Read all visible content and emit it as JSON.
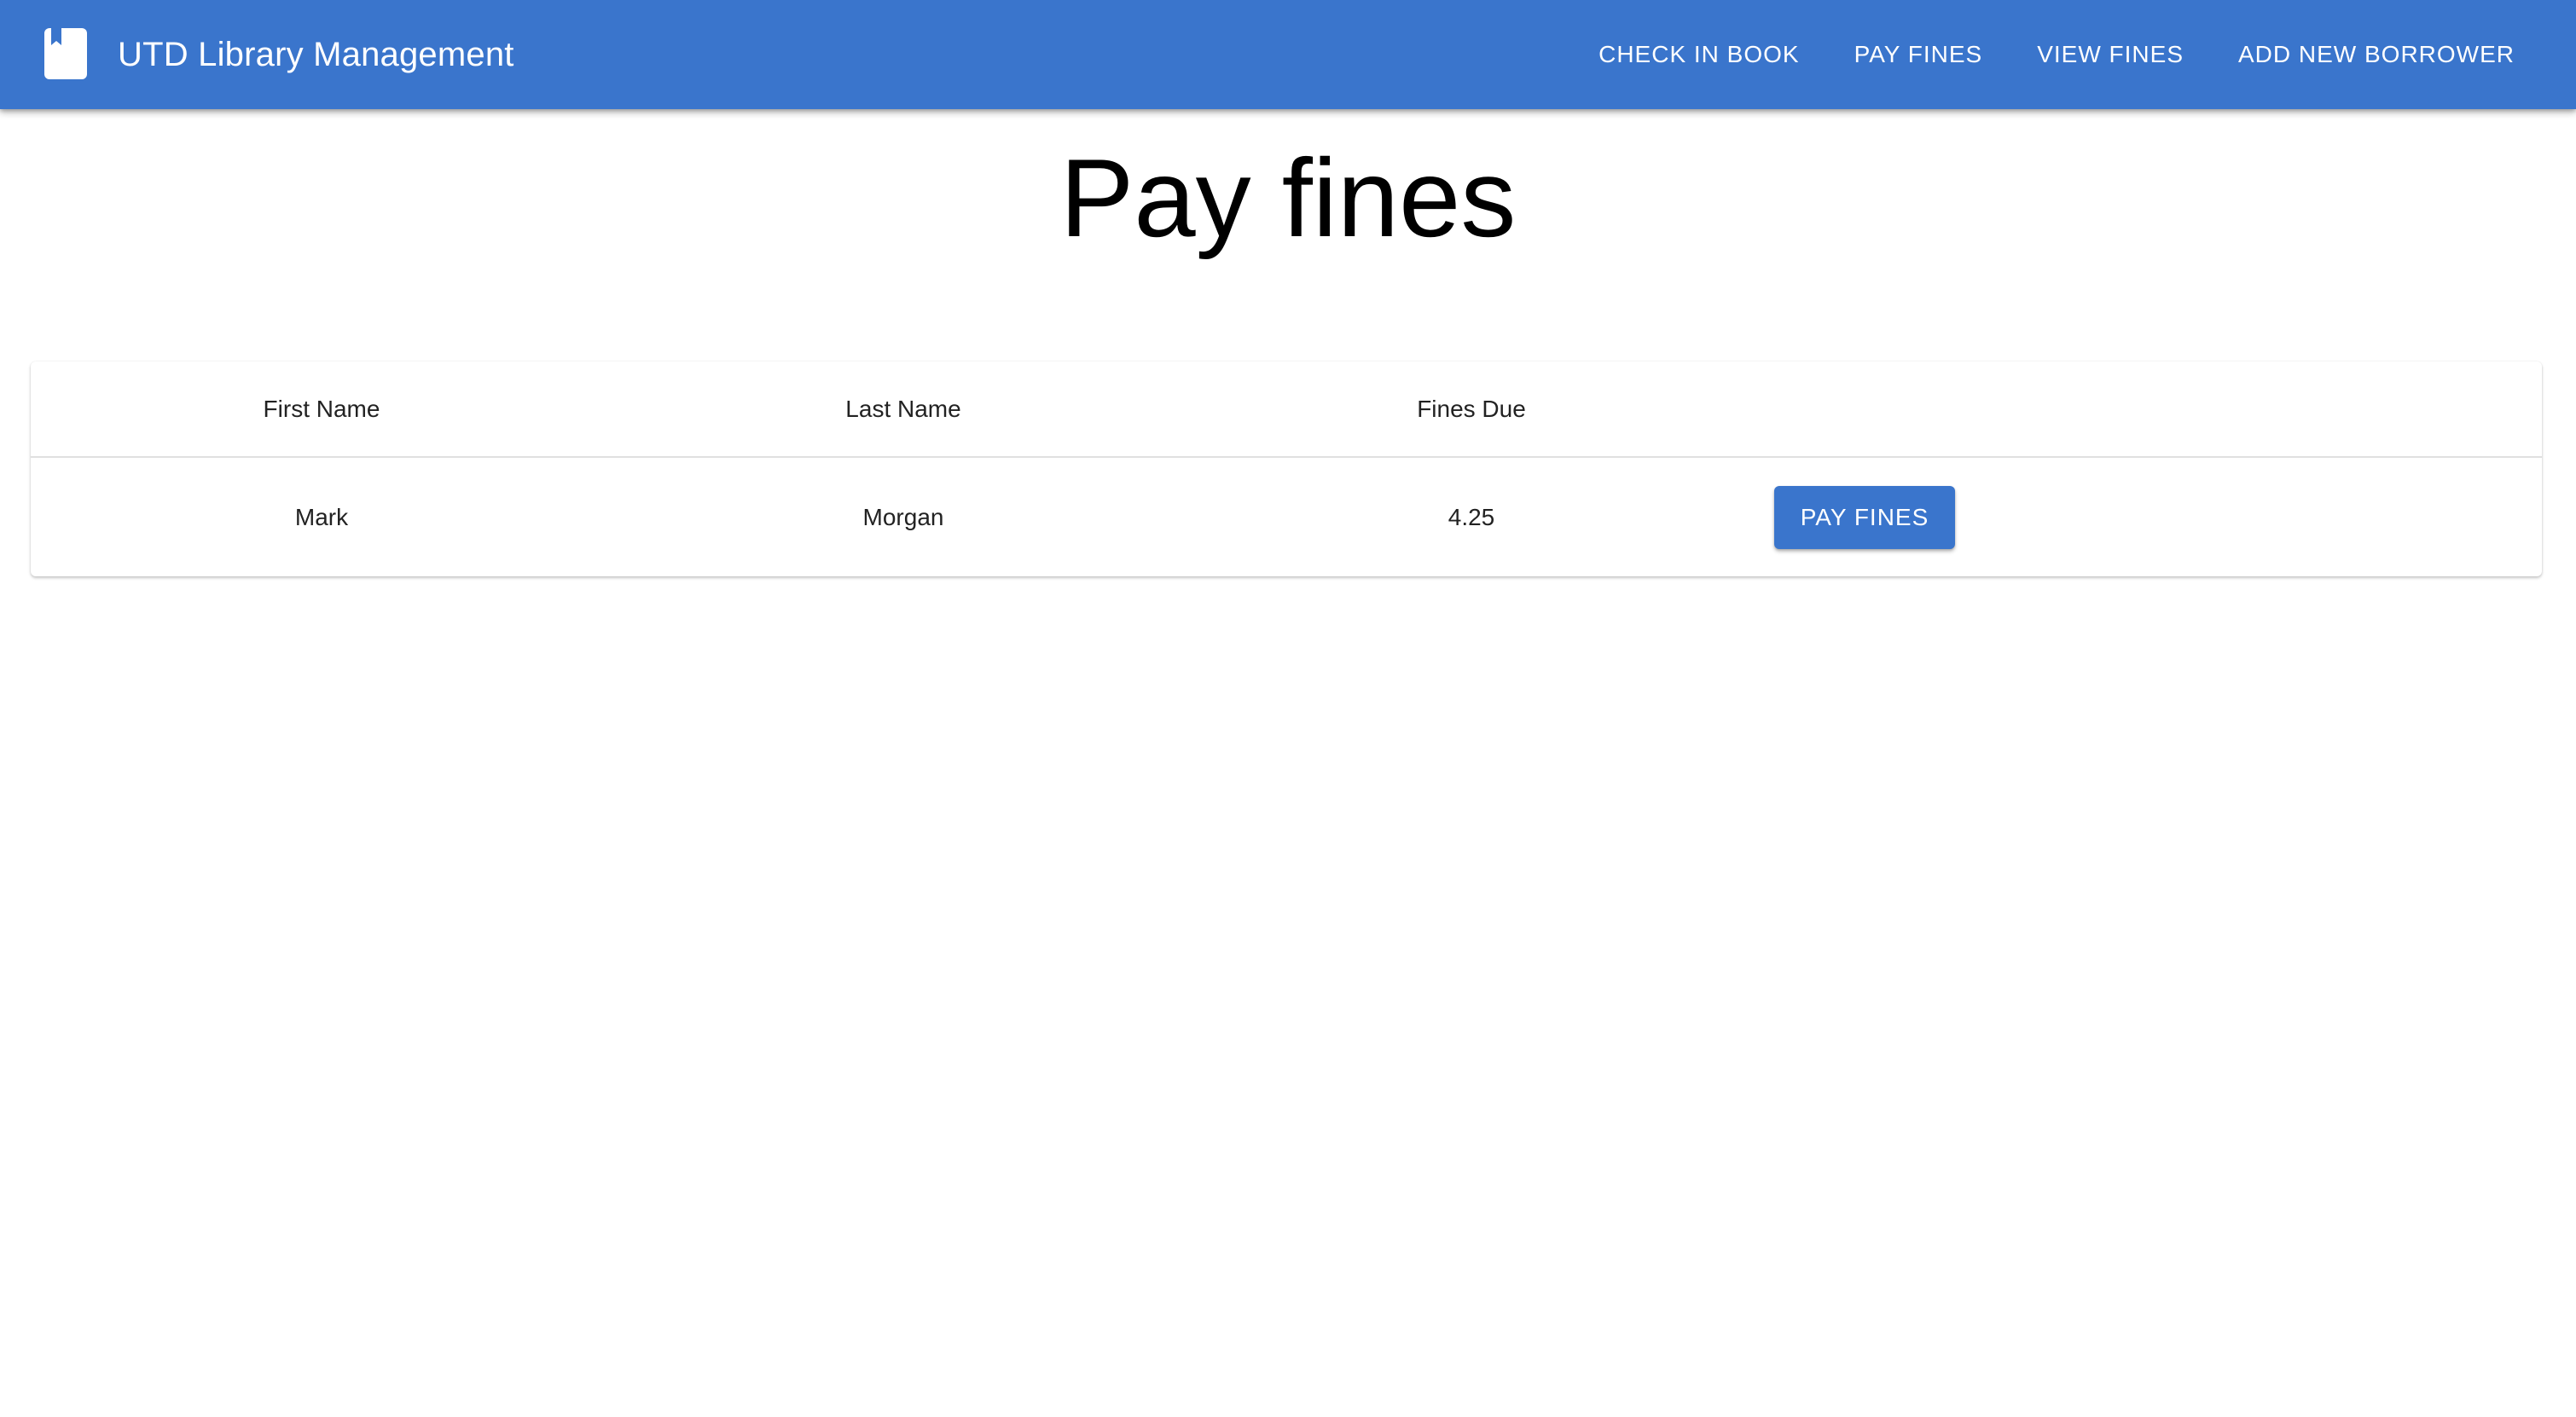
{
  "app": {
    "title": "UTD Library Management",
    "icon": "book-icon",
    "accent_color": "#3a75cc"
  },
  "nav": {
    "items": [
      {
        "label": "CHECK IN BOOK"
      },
      {
        "label": "PAY FINES"
      },
      {
        "label": "VIEW FINES"
      },
      {
        "label": "ADD NEW BORROWER"
      }
    ]
  },
  "page": {
    "title": "Pay fines"
  },
  "table": {
    "columns": [
      "First Name",
      "Last Name",
      "Fines Due",
      ""
    ],
    "rows": [
      {
        "first_name": "Mark",
        "last_name": "Morgan",
        "fines_due": "4.25",
        "action_label": "PAY FINES"
      }
    ]
  }
}
